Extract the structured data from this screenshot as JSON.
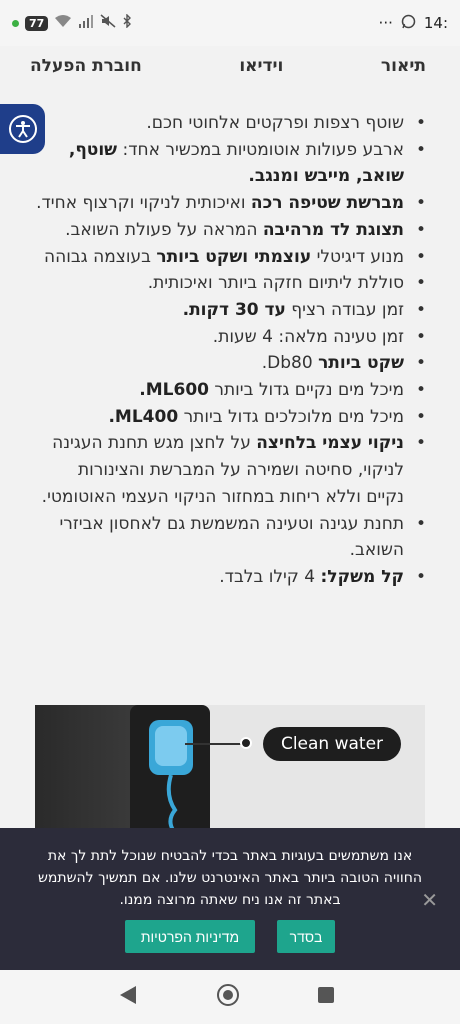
{
  "status_bar": {
    "battery": "77",
    "time": "14:",
    "dots": "···"
  },
  "tabs": [
    {
      "label": "תיאור"
    },
    {
      "label": "וידיאו"
    },
    {
      "label": "חוברת הפעלה"
    }
  ],
  "features": [
    [
      {
        "t": "שוטף רצפות ופרקטים אלחוטי חכם."
      }
    ],
    [
      {
        "t": "ארבע פעולות אוטומטיות במכשיר אחד: "
      },
      {
        "t": "שוטף, שואב, מייבש ומנגב.",
        "b": true
      }
    ],
    [
      {
        "t": "מברשת שטיפה רכה",
        "b": true
      },
      {
        "t": " ואיכותית לניקוי וקרצוף אחיד."
      }
    ],
    [
      {
        "t": "תצוגת לד מרהיבה",
        "b": true
      },
      {
        "t": " המראה על פעולת השואב."
      }
    ],
    [
      {
        "t": "מנוע דיגיטלי "
      },
      {
        "t": "עוצמתי ושקט ביותר",
        "b": true
      },
      {
        "t": " בעוצמה גבוהה"
      }
    ],
    [
      {
        "t": "סוללת ליתיום חזקה ביותר ואיכותית."
      }
    ],
    [
      {
        "t": "זמן עבודה רציף "
      },
      {
        "t": "עד 30 דקות.",
        "b": true
      }
    ],
    [
      {
        "t": "זמן טעינה מלאה: 4 שעות."
      }
    ],
    [
      {
        "t": "שקט ביותר",
        "b": true
      },
      {
        "t": " Db80."
      }
    ],
    [
      {
        "t": "מיכל מים נקיים גדול ביותר "
      },
      {
        "t": "ML600.",
        "b": true
      }
    ],
    [
      {
        "t": "מיכל מים מלוכלכים גדול ביותר "
      },
      {
        "t": "ML400.",
        "b": true
      }
    ],
    [
      {
        "t": "ניקוי עצמי בלחיצה",
        "b": true
      },
      {
        "t": " על לחצן מגש תחנת העגינה לניקוי, סחיטה ושמירה על המברשת והצינורות נקיים וללא ריחות במחזור הניקוי העצמי האוטומטי."
      }
    ],
    [
      {
        "t": "תחנת עגינה וטעינה המשמשת גם לאחסון אביזרי השואב."
      }
    ],
    [
      {
        "t": "קל משקל:",
        "b": true
      },
      {
        "t": " 4 קילו בלבד."
      }
    ]
  ],
  "image": {
    "label": "Clean water"
  },
  "cookie": {
    "text": "אנו משתמשים בעוגיות באתר בכדי להבטיח שנוכל לתת לך את החוויה הטובה ביותר באתר האינטרנט שלנו. אם תמשיך להשתמש באתר זה אנו ניח שאתה מרוצה ממנו.",
    "ok_label": "בסדר",
    "privacy_label": "מדיניות הפרטיות",
    "close": "✕"
  }
}
